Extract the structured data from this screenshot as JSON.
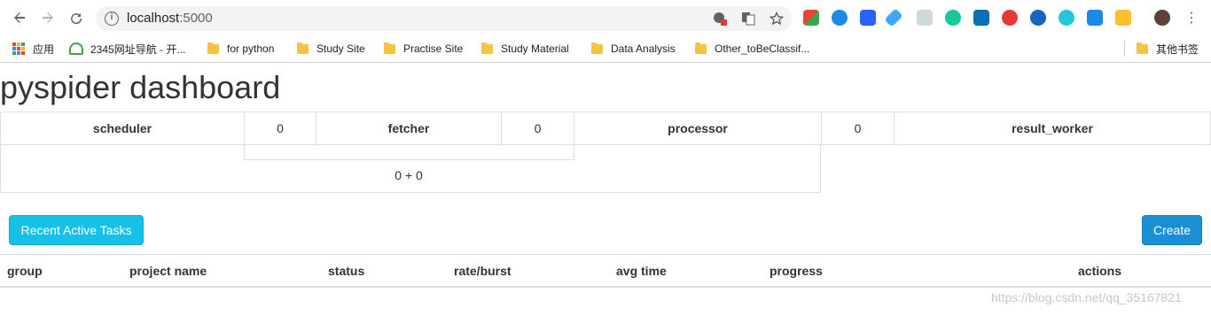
{
  "browser": {
    "url_host": "localhost",
    "url_port": ":5000",
    "bookmarks": [
      {
        "label": "应用"
      },
      {
        "label": "2345网址导航 - 开..."
      },
      {
        "label": "for python"
      },
      {
        "label": "Study Site"
      },
      {
        "label": "Practise Site"
      },
      {
        "label": "Study Material"
      },
      {
        "label": "Data Analysis"
      },
      {
        "label": "Other_toBeClassif..."
      },
      {
        "label": "其他书签"
      }
    ]
  },
  "dashboard": {
    "title": "pyspider dashboard",
    "stats": {
      "scheduler_label": "scheduler",
      "scheduler_value": "0",
      "fetcher_label": "fetcher",
      "fetcher_value": "0",
      "processor_label": "processor",
      "processor_value": "0",
      "result_worker_label": "result_worker",
      "sum": "0 + 0"
    },
    "recent_tasks_label": "Recent Active Tasks",
    "create_label": "Create",
    "columns": [
      "group",
      "project name",
      "status",
      "rate/burst",
      "avg time",
      "progress",
      "actions"
    ]
  },
  "watermark": "https://blog.csdn.net/qq_35167821"
}
